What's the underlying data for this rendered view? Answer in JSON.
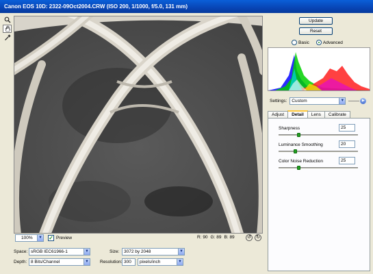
{
  "window": {
    "title": "Canon EOS 10D:  2322-09Oct2004.CRW  (ISO 200, 1/1000, f/5.0, 131 mm)"
  },
  "tools": [
    {
      "name": "zoom-icon",
      "glyph": "🔍"
    },
    {
      "name": "hand-icon",
      "glyph": "✋"
    },
    {
      "name": "eyedropper-icon",
      "glyph": "✒"
    }
  ],
  "preview": {
    "zoom": "100%",
    "preview_label": "Preview",
    "preview_checked": true,
    "rgb": {
      "r_label": "R:",
      "r": "90",
      "g_label": "G:",
      "g": "89",
      "b_label": "B:",
      "b": "89"
    },
    "rotate_left": "↺",
    "rotate_right": "↻"
  },
  "output": {
    "space_label": "Space:",
    "space": "sRGB IEC61966-1",
    "depth_label": "Depth:",
    "depth": "8 Bits/Channel",
    "size_label": "Size:",
    "size": "3072 by 2048",
    "resolution_label": "Resolution:",
    "resolution": "300",
    "resolution_unit": "pixels/inch"
  },
  "actions": {
    "update": "Update",
    "reset": "Reset"
  },
  "mode": {
    "basic": "Basic",
    "advanced": "Advanced",
    "selected": "advanced"
  },
  "histogram": {
    "colors": {
      "blue": "#2020ff",
      "green": "#00d000",
      "red": "#ff2020",
      "cyan": "#00d0d0",
      "magenta": "#e000e0",
      "yellow": "#e8e800"
    }
  },
  "settings": {
    "label": "Settings:",
    "value": "Custom"
  },
  "tabs": [
    {
      "label": "Adjust",
      "active": false
    },
    {
      "label": "Detail",
      "active": true
    },
    {
      "label": "Lens",
      "active": false
    },
    {
      "label": "Calibrate",
      "active": false
    }
  ],
  "detail": {
    "sharpness": {
      "label": "Sharpness",
      "value": "25",
      "fraction": 0.25
    },
    "luminance": {
      "label": "Luminance Smoothing",
      "value": "20",
      "fraction": 0.2
    },
    "color_noise": {
      "label": "Color Noise Reduction",
      "value": "25",
      "fraction": 0.25
    }
  }
}
